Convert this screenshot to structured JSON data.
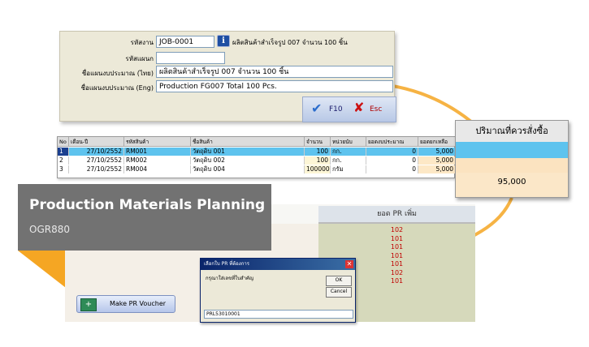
{
  "form": {
    "job_label": "รหัสงาน",
    "job_value": "JOB-0001",
    "job_desc": "ผลิตสินค้าสำเร็จรูป 007 จำนวน 100 ชิ้น",
    "dept_label": "รหัสแผนก",
    "dept_value": "",
    "name_th_label": "ชื่อแผนงบประมาณ (ไทย)",
    "name_th_value": "ผลิตสินค้าสำเร็จรูป 007 จำนวน 100 ชิ้น",
    "name_en_label": "ชื่อแผนงบประมาณ (Eng)",
    "name_en_value": "Production FG007 Total 100 Pcs.",
    "f10_label": "F10",
    "esc_label": "Esc"
  },
  "grid": {
    "headers": [
      "No",
      "เดือน-ปี",
      "รหัสสินค้า",
      "ชื่อสินค้า",
      "จำนวน",
      "หน่วยนับ",
      "ยอดงบประมาณ",
      "ยอดยกเหลือ"
    ],
    "rows": [
      [
        "1",
        "27/10/2552",
        "RM001",
        "วัตถุดิบ 001",
        "100",
        "กก.",
        "0",
        "5,000"
      ],
      [
        "2",
        "27/10/2552",
        "RM002",
        "วัตถุดิบ 002",
        "100",
        "กก.",
        "0",
        "5,000"
      ],
      [
        "3",
        "27/10/2552",
        "RM004",
        "วัตถุดิบ 004",
        "100000",
        "กรัม",
        "0",
        "5,000"
      ]
    ]
  },
  "order_panel": {
    "title": "ปริมาณที่ควรสั่งซื้อ",
    "value": "95,000"
  },
  "banner": {
    "title": "Production Materials Planning",
    "code": "OGR880"
  },
  "pr_grid": {
    "header": "ยอด PR เพิ่ม",
    "values": [
      "102",
      "101",
      "101",
      "101",
      "101",
      "102",
      "101"
    ]
  },
  "pr_button": {
    "label": "Make PR Voucher"
  },
  "dialog": {
    "title": "เลือกใบ PR ที่ต้องการ",
    "message": "กรุณาใส่เลขที่ใบสำคัญ",
    "ok_label": "OK",
    "cancel_label": "Cancel",
    "input_value": "PRL53010001"
  },
  "colors": {
    "accent_orange": "#f5a623",
    "selected_row": "#5ec3ee",
    "banner_gray": "#727272"
  }
}
